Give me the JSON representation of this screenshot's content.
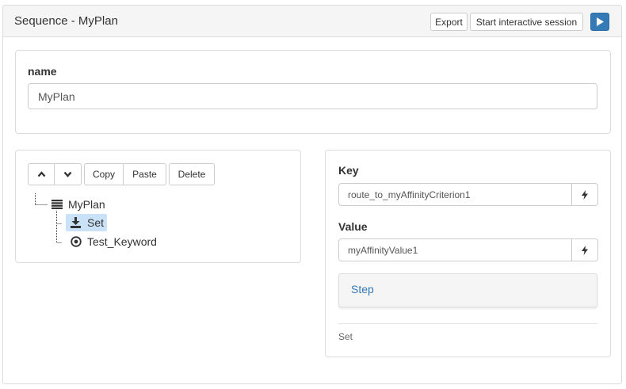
{
  "header": {
    "title": "Sequence - MyPlan",
    "export_label": "Export",
    "session_label": "Start interactive session",
    "run_icon": "play-icon"
  },
  "name_section": {
    "label": "name",
    "value": "MyPlan"
  },
  "tree_toolbar": {
    "up_icon": "chevron-up-icon",
    "down_icon": "chevron-down-icon",
    "copy_label": "Copy",
    "paste_label": "Paste",
    "delete_label": "Delete"
  },
  "tree": {
    "root": {
      "label": "MyPlan",
      "icon": "list-icon"
    },
    "children": [
      {
        "label": "Set",
        "icon": "download-icon",
        "selected": true
      },
      {
        "label": "Test_Keyword",
        "icon": "target-icon",
        "selected": false
      }
    ]
  },
  "properties": {
    "key_label": "Key",
    "key_value": "route_to_myAffinityCriterion1",
    "value_label": "Value",
    "value_value": "myAffinityValue1",
    "addon_icon": "lightning-icon",
    "step_label": "Step",
    "footer": "Set"
  },
  "colors": {
    "primary": "#337ab7",
    "selection": "#c9e2f7",
    "border": "#dcdcdc",
    "heading_bg": "#f5f5f5"
  }
}
